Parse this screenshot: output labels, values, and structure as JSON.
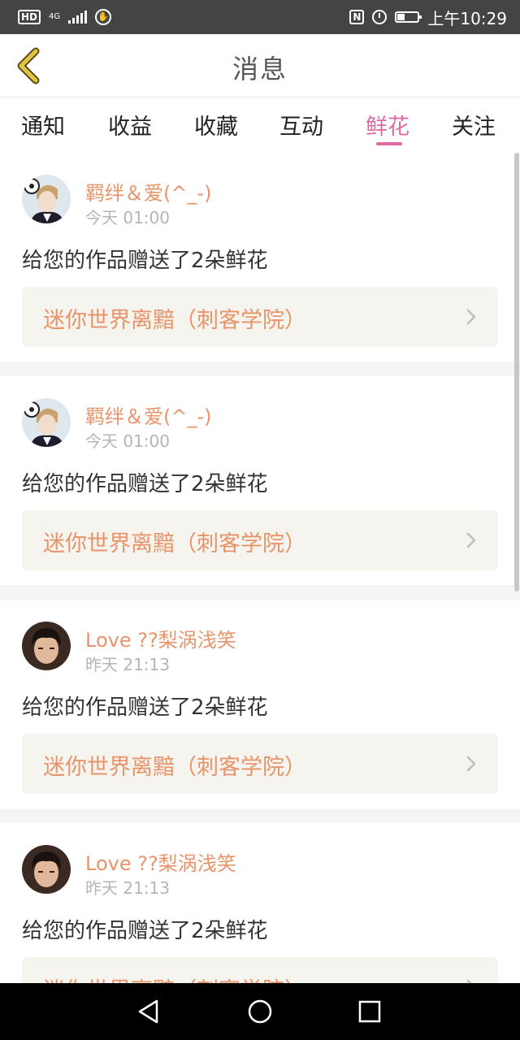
{
  "status_bar": {
    "hd": "HD",
    "network": "4G",
    "time": "上午10:29",
    "nfc": "N"
  },
  "header": {
    "title": "消息"
  },
  "tabs": [
    {
      "label": "通知",
      "active": false
    },
    {
      "label": "收益",
      "active": false
    },
    {
      "label": "收藏",
      "active": false
    },
    {
      "label": "互动",
      "active": false
    },
    {
      "label": "鲜花",
      "active": true
    },
    {
      "label": "关注",
      "active": false
    }
  ],
  "messages": [
    {
      "username": "羁绊＆爱(^_-)",
      "time": "今天 01:00",
      "text": "给您的作品赠送了2朵鲜花",
      "work_title": "迷你世界离黯（刺客学院）",
      "avatar": "anime-avatar"
    },
    {
      "username": "羁绊＆爱(^_-)",
      "time": "今天 01:00",
      "text": "给您的作品赠送了2朵鲜花",
      "work_title": "迷你世界离黯（刺客学院）",
      "avatar": "anime-avatar"
    },
    {
      "username": "Love ??梨涡浅笑",
      "time": "昨天 21:13",
      "text": "给您的作品赠送了2朵鲜花",
      "work_title": "迷你世界离黯（刺客学院）",
      "avatar": "photo-avatar"
    },
    {
      "username": "Love ??梨涡浅笑",
      "time": "昨天 21:13",
      "text": "给您的作品赠送了2朵鲜花",
      "work_title": "迷你世界离黯（刺客学院）",
      "avatar": "photo-avatar"
    }
  ],
  "colors": {
    "accent_pink": "#e06aa0",
    "accent_orange": "#e8946a",
    "back_arrow": "#c9b13a"
  }
}
